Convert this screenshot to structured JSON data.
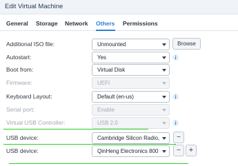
{
  "window": {
    "title": "Edit Virtual Machine"
  },
  "tabs": [
    {
      "label": "General"
    },
    {
      "label": "Storage"
    },
    {
      "label": "Network"
    },
    {
      "label": "Others"
    },
    {
      "label": "Permissions"
    }
  ],
  "active_tab": "Others",
  "form": {
    "iso": {
      "label": "Additional ISO file:",
      "value": "Unmounted",
      "button": "Browse"
    },
    "autostart": {
      "label": "Autostart:",
      "value": "Yes"
    },
    "boot": {
      "label": "Boot from:",
      "value": "Virtual Disk"
    },
    "firmware": {
      "label": "Firmware:",
      "value": "UEFI",
      "disabled": true
    },
    "keyboard": {
      "label": "Keyboard Layout:",
      "value": "Default (en-us)"
    },
    "serial": {
      "label": "Serial port:",
      "value": "Enable",
      "disabled": true
    },
    "usb_controller": {
      "label": "Virtual USB Controller:",
      "value": "USB 2.0",
      "disabled": true
    },
    "usb1": {
      "label": "USB device:",
      "value": "Cambridge Silicon Radio,",
      "remove": "−"
    },
    "usb2": {
      "label": "USB device:",
      "value": "QinHeng Electronics 800",
      "remove": "−",
      "add": "+"
    }
  },
  "colors": {
    "accent": "#2a7fd6",
    "annotation": "#2fd020"
  }
}
